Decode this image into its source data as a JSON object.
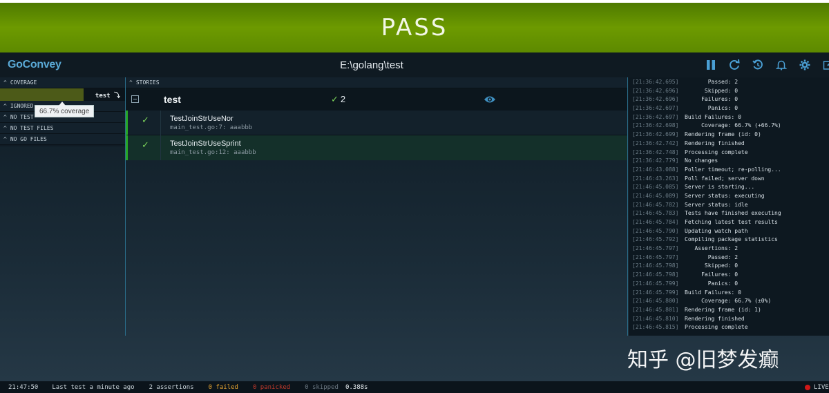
{
  "banner": {
    "status": "PASS"
  },
  "topbar": {
    "brand": "GoConvey",
    "path": "E:\\golang\\test",
    "tools": [
      "pause-icon",
      "refresh-icon",
      "history-icon",
      "bell-icon",
      "gear-icon",
      "edit-icon"
    ]
  },
  "left": {
    "coverage_header": "COVERAGE",
    "coverage": {
      "package": "test ⤵",
      "percent": 0.667
    },
    "tooltip": "66.7% coverage",
    "ignored_header": "IGNORED",
    "no_test_header": "NO TEST",
    "no_test_files_header": "NO TEST FILES",
    "no_go_files_header": "NO GO FILES"
  },
  "stories": {
    "header": "STORIES",
    "package": {
      "name": "test",
      "count_mark": "✓",
      "count": "2"
    },
    "tests": [
      {
        "check": "✓",
        "name": "TestJoinStrUseNor",
        "location": "main_test.go:7: aaabbb"
      },
      {
        "check": "✓",
        "name": "TestJoinStrUseSprint",
        "location": "main_test.go:12: aaabbb"
      }
    ]
  },
  "log": [
    {
      "ts": "[21:36:42.695]",
      "msg": "       Passed: 2"
    },
    {
      "ts": "[21:36:42.696]",
      "msg": "      Skipped: 0"
    },
    {
      "ts": "[21:36:42.696]",
      "msg": "     Failures: 0"
    },
    {
      "ts": "[21:36:42.697]",
      "msg": "       Panics: 0"
    },
    {
      "ts": "[21:36:42.697]",
      "msg": "Build Failures: 0"
    },
    {
      "ts": "[21:36:42.698]",
      "msg": "     Coverage: 66.7% (+66.7%)"
    },
    {
      "ts": "[21:36:42.699]",
      "msg": "Rendering frame (id: 0)"
    },
    {
      "ts": "[21:36:42.742]",
      "msg": "Rendering finished"
    },
    {
      "ts": "[21:36:42.748]",
      "msg": "Processing complete"
    },
    {
      "ts": "[21:36:42.779]",
      "msg": "No changes"
    },
    {
      "ts": "[21:46:43.088]",
      "msg": "Poller timeout; re-polling..."
    },
    {
      "ts": "[21:46:43.263]",
      "msg": "Poll failed; server down"
    },
    {
      "ts": "[21:46:45.085]",
      "msg": "Server is starting..."
    },
    {
      "ts": "[21:46:45.089]",
      "msg": "Server status: executing"
    },
    {
      "ts": "[21:46:45.782]",
      "msg": "Server status: idle"
    },
    {
      "ts": "[21:46:45.783]",
      "msg": "Tests have finished executing"
    },
    {
      "ts": "[21:46:45.784]",
      "msg": "Fetching latest test results"
    },
    {
      "ts": "[21:46:45.790]",
      "msg": "Updating watch path"
    },
    {
      "ts": "[21:46:45.792]",
      "msg": "Compiling package statistics"
    },
    {
      "ts": "[21:46:45.797]",
      "msg": "   Assertions: 2"
    },
    {
      "ts": "[21:46:45.797]",
      "msg": "       Passed: 2"
    },
    {
      "ts": "[21:46:45.798]",
      "msg": "      Skipped: 0"
    },
    {
      "ts": "[21:46:45.798]",
      "msg": "     Failures: 0"
    },
    {
      "ts": "[21:46:45.799]",
      "msg": "       Panics: 0"
    },
    {
      "ts": "[21:46:45.799]",
      "msg": "Build Failures: 0"
    },
    {
      "ts": "[21:46:45.800]",
      "msg": "     Coverage: 66.7% (±0%)"
    },
    {
      "ts": "[21:46:45.801]",
      "msg": "Rendering frame (id: 1)"
    },
    {
      "ts": "[21:46:45.810]",
      "msg": "Rendering finished"
    },
    {
      "ts": "[21:46:45.815]",
      "msg": "Processing complete"
    }
  ],
  "watermark": "知乎 @旧梦发癫",
  "footer": {
    "time": "21:47:50",
    "last_test": "Last test a minute ago",
    "assertions": "2 assertions",
    "failed": "0 failed",
    "panicked": "0 panicked",
    "skipped": "0 skipped",
    "duration": "0.388s",
    "live": "LIVE"
  },
  "colors": {
    "pass_green": "#6d9a00",
    "brand_blue": "#5aa9d6",
    "ok_check": "#7bd35a",
    "live_red": "#d01818"
  }
}
